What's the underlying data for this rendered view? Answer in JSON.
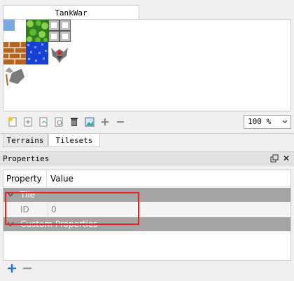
{
  "tileset": {
    "tab_title": "TankWar",
    "zoom": "100 %",
    "toolbar_icons": [
      "new-tileset-icon",
      "embed-tileset-icon",
      "export-tileset-icon",
      "edit-tileset-icon",
      "delete-tileset-icon",
      "image-tileset-icon",
      "add-icon",
      "remove-icon"
    ]
  },
  "bottom_tabs": {
    "terrains": "Terrains",
    "tilesets": "Tilesets"
  },
  "properties": {
    "title": "Properties",
    "col_property": "Property",
    "col_value": "Value",
    "groups": [
      {
        "label": "Tile",
        "rows": [
          {
            "name": "ID",
            "value": "0"
          }
        ]
      },
      {
        "label": "Custom Properties",
        "rows": []
      }
    ]
  },
  "colors": {
    "group_bg": "#a3a3a3",
    "highlight": "#e02424"
  }
}
